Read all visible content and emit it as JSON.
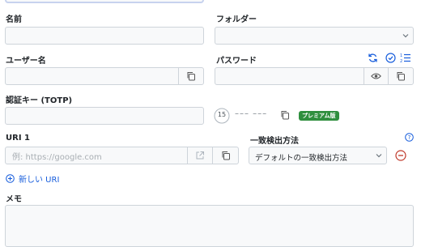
{
  "top_field": {
    "value": ""
  },
  "name": {
    "label": "名前",
    "value": ""
  },
  "folder": {
    "label": "フォルダー",
    "value": ""
  },
  "username": {
    "label": "ユーザー名",
    "value": ""
  },
  "password": {
    "label": "パスワード",
    "value": ""
  },
  "totp": {
    "label": "認証キー (TOTP)",
    "value": "",
    "countdown": "15",
    "code_placeholder": "––– –––",
    "premium_badge": "プレミアム版"
  },
  "uri": {
    "label": "URI 1",
    "placeholder": "例: https://google.com",
    "value": ""
  },
  "match": {
    "label": "一致検出方法",
    "selected": "デフォルトの一致検出方法"
  },
  "new_uri": {
    "label": "新しい URI"
  },
  "notes": {
    "label": "メモ",
    "value": ""
  },
  "colors": {
    "accent": "#175ddc",
    "premium": "#2f8f3e",
    "remove": "#c0392b"
  },
  "icons": [
    "copy-icon",
    "refresh-icon",
    "check-circle-icon",
    "list-ordered-icon",
    "eye-icon",
    "launch-icon",
    "help-icon",
    "minus-circle-icon",
    "plus-circle-icon",
    "chevron-down-icon",
    "timer-icon"
  ]
}
